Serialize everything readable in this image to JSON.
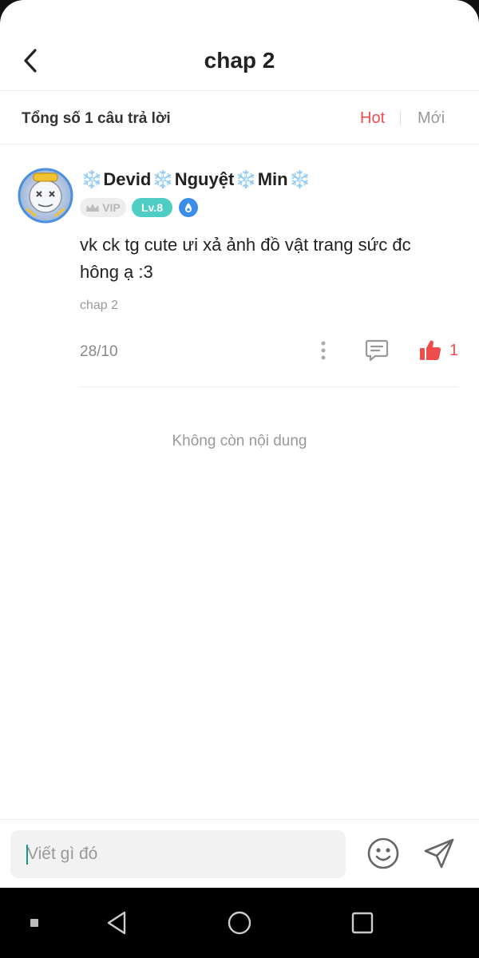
{
  "header": {
    "title": "chap 2",
    "back_icon": "chevron-left-icon"
  },
  "sortbar": {
    "total": "Tổng số 1 câu trả lời",
    "hot": "Hot",
    "new": "Mới",
    "active_color": "#ee4d4d"
  },
  "comment": {
    "user": {
      "name_parts": [
        "Devid",
        "Nguyệt",
        "Min"
      ],
      "flake": "❄️",
      "vip": "VIP",
      "level": "Lv.8"
    },
    "text": "vk ck tg cute ưi xả ảnh đồ vật trang sức đc hông ạ :3",
    "chapter": "chap 2",
    "date": "28/10",
    "likes": "1"
  },
  "end_message": "Không còn nội dung",
  "composer": {
    "placeholder": "Viết gì đó"
  },
  "colors": {
    "accent": "#ee4d4d",
    "level_badge": "#4ecdc4",
    "medal": "#3d8ee8"
  }
}
